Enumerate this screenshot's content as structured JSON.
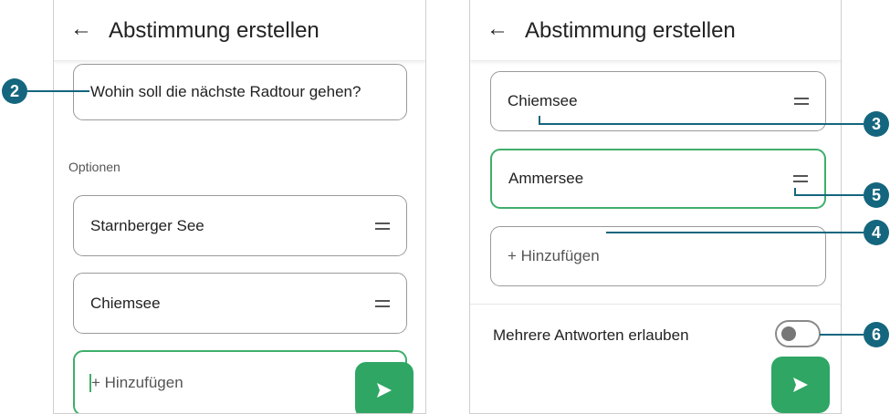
{
  "left_screen": {
    "back_icon": "arrow-left-icon",
    "title": "Abstimmung erstellen",
    "question": "Wohin soll die nächste Radtour gehen?",
    "section_label": "Optionen",
    "options": [
      "Starnberger See",
      "Chiemsee"
    ],
    "add_placeholder": "+ Hinzufügen",
    "send_icon": "send-icon"
  },
  "right_screen": {
    "back_icon": "arrow-left-icon",
    "title": "Abstimmung erstellen",
    "options": [
      "Chiemsee",
      "Ammersee"
    ],
    "add_placeholder": "+ Hinzufügen",
    "toggle_label": "Mehrere Antworten erlauben",
    "toggle_on": false,
    "send_icon": "send-icon"
  },
  "callouts": [
    "2",
    "3",
    "4",
    "5",
    "6"
  ],
  "colors": {
    "accent": "#2fa664",
    "active_border": "#3fae6b",
    "callout": "#14667e"
  }
}
